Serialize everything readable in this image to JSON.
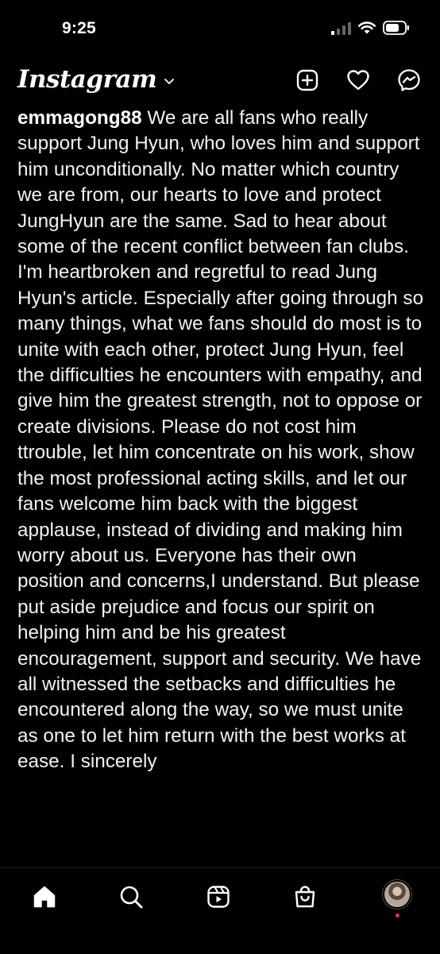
{
  "status_bar": {
    "time": "9:25",
    "icons": [
      "cellular-signal-icon",
      "wifi-icon",
      "battery-icon"
    ]
  },
  "header": {
    "logo": "Instagram",
    "icons": [
      "chevron-down-icon",
      "new-post-icon",
      "heart-icon",
      "messenger-icon"
    ]
  },
  "post": {
    "username": "emmagong88",
    "caption": "We are all fans who really support Jung Hyun, who loves him and support him unconditionally.  No matter which country we are from, our hearts to love and protect JungHyun are the same.  Sad to hear about some of the recent conflict between fan clubs.  I'm heartbroken and regretful to read Jung Hyun's article. Especially after going through so many things, what we fans should do most is to unite with each other, protect Jung Hyun, feel the difficulties he encounters with empathy, and give him the greatest strength, not to oppose or create divisions.  Please do not cost him ttrouble, let him concentrate on his work, show the most professional acting skills, and let our fans welcome him back with the biggest applause, instead of dividing and making him worry about us. Everyone has their own position and concerns,I understand.  But please put aside prejudice and focus our spirit on helping him and be his greatest encouragement, support and security.  We have all witnessed the setbacks and difficulties he encountered along the way, so we must unite as one to let him return with the best works at ease.  I sincerely"
  },
  "bottom_nav": {
    "items": [
      "home-icon",
      "search-icon",
      "reels-icon",
      "shop-icon",
      "profile-avatar"
    ]
  },
  "colors": {
    "background": "#000000",
    "text": "#ffffff",
    "notification_dot": "#ff3040"
  }
}
